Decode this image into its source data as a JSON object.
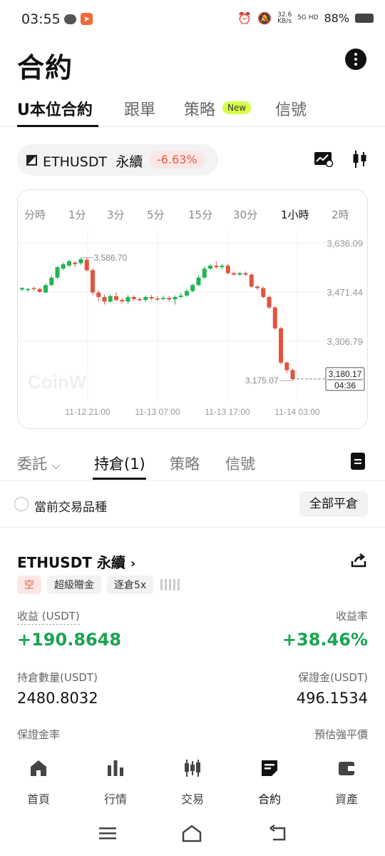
{
  "status_bar": {
    "time": "03:55",
    "speed_top": "32.6",
    "speed_bottom": "KB/s",
    "signal": "5G HD",
    "battery": "88%"
  },
  "header": {
    "title": "合約"
  },
  "main_tabs": [
    {
      "label": "U本位合約",
      "active": true
    },
    {
      "label": "跟單"
    },
    {
      "label": "策略",
      "badge": "New"
    },
    {
      "label": "信號"
    }
  ],
  "symbol_bar": {
    "symbol": "ETHUSDT",
    "type": "永續",
    "change": "-6.63%"
  },
  "intervals": [
    "分時",
    "1分",
    "3分",
    "5分",
    "15分",
    "30分",
    "1小時",
    "2時"
  ],
  "active_interval": "1小時",
  "chart_data": {
    "type": "candlestick",
    "y_ticks": [
      "3,636.09",
      "3,471.44",
      "3,306.79"
    ],
    "x_ticks": [
      "11-12 21:00",
      "11-13 07:00",
      "11-13 17:00",
      "11-14 03:00"
    ],
    "high_label": "3,586.70",
    "low_label": "3,175.07",
    "last_price": "3,180.17",
    "countdown": "04:36",
    "watermark": "CoinW",
    "ylim": [
      3120,
      3680
    ],
    "colors": {
      "up": "#22b454",
      "down": "#e5533d"
    },
    "candles": [
      [
        3480,
        3485,
        3475,
        3488
      ],
      [
        3478,
        3482,
        3472,
        3486
      ],
      [
        3485,
        3482,
        3475,
        3490
      ],
      [
        3482,
        3472,
        3468,
        3486
      ],
      [
        3470,
        3495,
        3468,
        3500
      ],
      [
        3495,
        3520,
        3490,
        3528
      ],
      [
        3520,
        3555,
        3515,
        3560
      ],
      [
        3550,
        3565,
        3545,
        3572
      ],
      [
        3560,
        3575,
        3555,
        3580
      ],
      [
        3570,
        3565,
        3555,
        3576
      ],
      [
        3568,
        3582,
        3562,
        3587
      ],
      [
        3580,
        3545,
        3540,
        3586
      ],
      [
        3545,
        3470,
        3460,
        3552
      ],
      [
        3470,
        3455,
        3440,
        3478
      ],
      [
        3455,
        3440,
        3430,
        3462
      ],
      [
        3440,
        3458,
        3435,
        3465
      ],
      [
        3458,
        3445,
        3440,
        3470
      ],
      [
        3445,
        3440,
        3435,
        3452
      ],
      [
        3440,
        3455,
        3432,
        3462
      ],
      [
        3455,
        3448,
        3440,
        3460
      ],
      [
        3448,
        3445,
        3440,
        3455
      ],
      [
        3445,
        3455,
        3438,
        3460
      ],
      [
        3455,
        3450,
        3445,
        3462
      ],
      [
        3450,
        3448,
        3442,
        3458
      ],
      [
        3448,
        3452,
        3444,
        3460
      ],
      [
        3452,
        3447,
        3440,
        3458
      ],
      [
        3447,
        3455,
        3430,
        3460
      ],
      [
        3455,
        3460,
        3450,
        3470
      ],
      [
        3460,
        3475,
        3455,
        3482
      ],
      [
        3475,
        3495,
        3470,
        3500
      ],
      [
        3495,
        3520,
        3490,
        3528
      ],
      [
        3520,
        3550,
        3515,
        3558
      ],
      [
        3550,
        3560,
        3545,
        3566
      ],
      [
        3560,
        3555,
        3550,
        3575
      ],
      [
        3555,
        3560,
        3548,
        3566
      ],
      [
        3560,
        3535,
        3530,
        3565
      ],
      [
        3535,
        3530,
        3528,
        3540
      ],
      [
        3530,
        3535,
        3525,
        3540
      ],
      [
        3535,
        3530,
        3525,
        3540
      ],
      [
        3530,
        3490,
        3485,
        3535
      ],
      [
        3490,
        3485,
        3478,
        3495
      ],
      [
        3485,
        3455,
        3450,
        3490
      ],
      [
        3455,
        3420,
        3415,
        3460
      ],
      [
        3420,
        3350,
        3345,
        3425
      ],
      [
        3350,
        3235,
        3228,
        3355
      ],
      [
        3235,
        3210,
        3200,
        3240
      ],
      [
        3210,
        3180,
        3175,
        3215
      ]
    ]
  },
  "position_tabs": [
    {
      "label": "委託",
      "dropdown": true
    },
    {
      "label": "持倉(1)",
      "active": true
    },
    {
      "label": "策略"
    },
    {
      "label": "信號"
    }
  ],
  "filter": {
    "label": "當前交易品種",
    "close_all": "全部平倉"
  },
  "position": {
    "symbol": "ETHUSDT 永續",
    "tags": [
      "空",
      "超級贈金",
      "逐倉5x"
    ],
    "pnl_label": "收益 (USDT)",
    "pnl_value": "+190.8648",
    "roe_label": "收益率",
    "roe_value": "+38.46%",
    "qty_label": "持倉數量(USDT)",
    "qty_value": "2480.8032",
    "margin_label": "保證金(USDT)",
    "margin_value": "496.1534",
    "margin_ratio_label": "保證金率",
    "liq_label": "預估強平價"
  },
  "bottom_nav": [
    {
      "label": "首頁",
      "icon": "home-icon"
    },
    {
      "label": "行情",
      "icon": "market-icon"
    },
    {
      "label": "交易",
      "icon": "trade-icon"
    },
    {
      "label": "合約",
      "icon": "futures-icon",
      "active": true
    },
    {
      "label": "資產",
      "icon": "wallet-icon"
    }
  ]
}
